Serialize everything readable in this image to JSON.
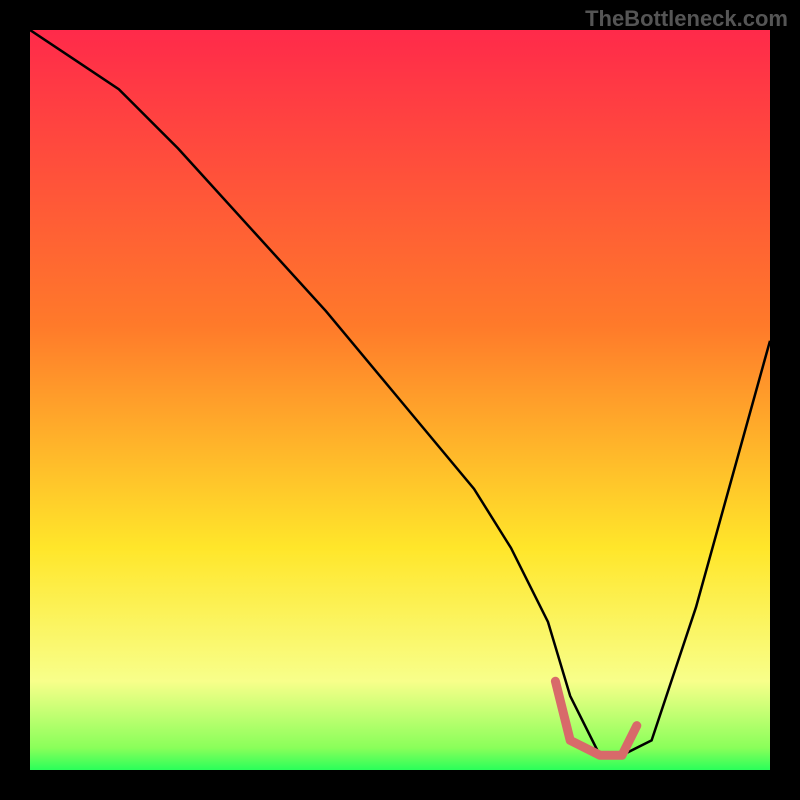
{
  "watermark": "TheBottleneck.com",
  "chart_data": {
    "type": "line",
    "title": "",
    "xlabel": "",
    "ylabel": "",
    "xlim": [
      0,
      100
    ],
    "ylim": [
      0,
      100
    ],
    "grid": false,
    "series": [
      {
        "name": "curve",
        "x": [
          0,
          6,
          12,
          20,
          30,
          40,
          50,
          60,
          65,
          70,
          73,
          77,
          80,
          84,
          90,
          95,
          100
        ],
        "y": [
          100,
          96,
          92,
          84,
          73,
          62,
          50,
          38,
          30,
          20,
          10,
          2,
          2,
          4,
          22,
          40,
          58
        ]
      },
      {
        "name": "marker-segment",
        "x": [
          71,
          73,
          77,
          80,
          82
        ],
        "y": [
          12,
          4,
          2,
          2,
          6
        ]
      }
    ],
    "gradient_stops": [
      {
        "offset": 0,
        "color": "#ff2a4a"
      },
      {
        "offset": 40,
        "color": "#ff7a2a"
      },
      {
        "offset": 70,
        "color": "#ffe62a"
      },
      {
        "offset": 88,
        "color": "#f8ff8a"
      },
      {
        "offset": 97,
        "color": "#8aff5a"
      },
      {
        "offset": 100,
        "color": "#2aff5a"
      }
    ],
    "curve_color": "#000000",
    "marker_color": "#d86a6a"
  }
}
